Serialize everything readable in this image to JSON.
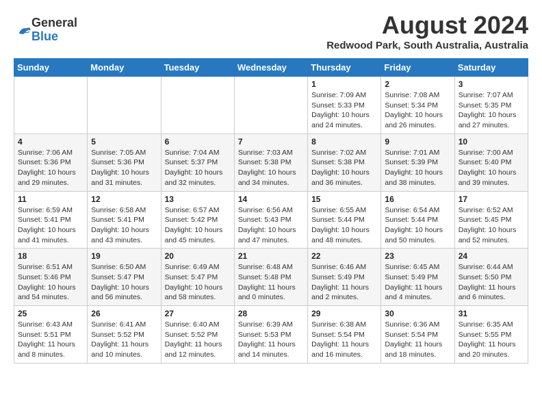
{
  "header": {
    "logo_general": "General",
    "logo_blue": "Blue",
    "title": "August 2024",
    "subtitle": "Redwood Park, South Australia, Australia"
  },
  "calendar": {
    "days": [
      "Sunday",
      "Monday",
      "Tuesday",
      "Wednesday",
      "Thursday",
      "Friday",
      "Saturday"
    ],
    "weeks": [
      [
        {
          "date": "",
          "sunrise": "",
          "sunset": "",
          "daylight": ""
        },
        {
          "date": "",
          "sunrise": "",
          "sunset": "",
          "daylight": ""
        },
        {
          "date": "",
          "sunrise": "",
          "sunset": "",
          "daylight": ""
        },
        {
          "date": "",
          "sunrise": "",
          "sunset": "",
          "daylight": ""
        },
        {
          "date": "1",
          "sunrise": "Sunrise: 7:09 AM",
          "sunset": "Sunset: 5:33 PM",
          "daylight": "Daylight: 10 hours and 24 minutes."
        },
        {
          "date": "2",
          "sunrise": "Sunrise: 7:08 AM",
          "sunset": "Sunset: 5:34 PM",
          "daylight": "Daylight: 10 hours and 26 minutes."
        },
        {
          "date": "3",
          "sunrise": "Sunrise: 7:07 AM",
          "sunset": "Sunset: 5:35 PM",
          "daylight": "Daylight: 10 hours and 27 minutes."
        }
      ],
      [
        {
          "date": "4",
          "sunrise": "Sunrise: 7:06 AM",
          "sunset": "Sunset: 5:36 PM",
          "daylight": "Daylight: 10 hours and 29 minutes."
        },
        {
          "date": "5",
          "sunrise": "Sunrise: 7:05 AM",
          "sunset": "Sunset: 5:36 PM",
          "daylight": "Daylight: 10 hours and 31 minutes."
        },
        {
          "date": "6",
          "sunrise": "Sunrise: 7:04 AM",
          "sunset": "Sunset: 5:37 PM",
          "daylight": "Daylight: 10 hours and 32 minutes."
        },
        {
          "date": "7",
          "sunrise": "Sunrise: 7:03 AM",
          "sunset": "Sunset: 5:38 PM",
          "daylight": "Daylight: 10 hours and 34 minutes."
        },
        {
          "date": "8",
          "sunrise": "Sunrise: 7:02 AM",
          "sunset": "Sunset: 5:38 PM",
          "daylight": "Daylight: 10 hours and 36 minutes."
        },
        {
          "date": "9",
          "sunrise": "Sunrise: 7:01 AM",
          "sunset": "Sunset: 5:39 PM",
          "daylight": "Daylight: 10 hours and 38 minutes."
        },
        {
          "date": "10",
          "sunrise": "Sunrise: 7:00 AM",
          "sunset": "Sunset: 5:40 PM",
          "daylight": "Daylight: 10 hours and 39 minutes."
        }
      ],
      [
        {
          "date": "11",
          "sunrise": "Sunrise: 6:59 AM",
          "sunset": "Sunset: 5:41 PM",
          "daylight": "Daylight: 10 hours and 41 minutes."
        },
        {
          "date": "12",
          "sunrise": "Sunrise: 6:58 AM",
          "sunset": "Sunset: 5:41 PM",
          "daylight": "Daylight: 10 hours and 43 minutes."
        },
        {
          "date": "13",
          "sunrise": "Sunrise: 6:57 AM",
          "sunset": "Sunset: 5:42 PM",
          "daylight": "Daylight: 10 hours and 45 minutes."
        },
        {
          "date": "14",
          "sunrise": "Sunrise: 6:56 AM",
          "sunset": "Sunset: 5:43 PM",
          "daylight": "Daylight: 10 hours and 47 minutes."
        },
        {
          "date": "15",
          "sunrise": "Sunrise: 6:55 AM",
          "sunset": "Sunset: 5:44 PM",
          "daylight": "Daylight: 10 hours and 48 minutes."
        },
        {
          "date": "16",
          "sunrise": "Sunrise: 6:54 AM",
          "sunset": "Sunset: 5:44 PM",
          "daylight": "Daylight: 10 hours and 50 minutes."
        },
        {
          "date": "17",
          "sunrise": "Sunrise: 6:52 AM",
          "sunset": "Sunset: 5:45 PM",
          "daylight": "Daylight: 10 hours and 52 minutes."
        }
      ],
      [
        {
          "date": "18",
          "sunrise": "Sunrise: 6:51 AM",
          "sunset": "Sunset: 5:46 PM",
          "daylight": "Daylight: 10 hours and 54 minutes."
        },
        {
          "date": "19",
          "sunrise": "Sunrise: 6:50 AM",
          "sunset": "Sunset: 5:47 PM",
          "daylight": "Daylight: 10 hours and 56 minutes."
        },
        {
          "date": "20",
          "sunrise": "Sunrise: 6:49 AM",
          "sunset": "Sunset: 5:47 PM",
          "daylight": "Daylight: 10 hours and 58 minutes."
        },
        {
          "date": "21",
          "sunrise": "Sunrise: 6:48 AM",
          "sunset": "Sunset: 5:48 PM",
          "daylight": "Daylight: 11 hours and 0 minutes."
        },
        {
          "date": "22",
          "sunrise": "Sunrise: 6:46 AM",
          "sunset": "Sunset: 5:49 PM",
          "daylight": "Daylight: 11 hours and 2 minutes."
        },
        {
          "date": "23",
          "sunrise": "Sunrise: 6:45 AM",
          "sunset": "Sunset: 5:49 PM",
          "daylight": "Daylight: 11 hours and 4 minutes."
        },
        {
          "date": "24",
          "sunrise": "Sunrise: 6:44 AM",
          "sunset": "Sunset: 5:50 PM",
          "daylight": "Daylight: 11 hours and 6 minutes."
        }
      ],
      [
        {
          "date": "25",
          "sunrise": "Sunrise: 6:43 AM",
          "sunset": "Sunset: 5:51 PM",
          "daylight": "Daylight: 11 hours and 8 minutes."
        },
        {
          "date": "26",
          "sunrise": "Sunrise: 6:41 AM",
          "sunset": "Sunset: 5:52 PM",
          "daylight": "Daylight: 11 hours and 10 minutes."
        },
        {
          "date": "27",
          "sunrise": "Sunrise: 6:40 AM",
          "sunset": "Sunset: 5:52 PM",
          "daylight": "Daylight: 11 hours and 12 minutes."
        },
        {
          "date": "28",
          "sunrise": "Sunrise: 6:39 AM",
          "sunset": "Sunset: 5:53 PM",
          "daylight": "Daylight: 11 hours and 14 minutes."
        },
        {
          "date": "29",
          "sunrise": "Sunrise: 6:38 AM",
          "sunset": "Sunset: 5:54 PM",
          "daylight": "Daylight: 11 hours and 16 minutes."
        },
        {
          "date": "30",
          "sunrise": "Sunrise: 6:36 AM",
          "sunset": "Sunset: 5:54 PM",
          "daylight": "Daylight: 11 hours and 18 minutes."
        },
        {
          "date": "31",
          "sunrise": "Sunrise: 6:35 AM",
          "sunset": "Sunset: 5:55 PM",
          "daylight": "Daylight: 11 hours and 20 minutes."
        }
      ]
    ]
  }
}
